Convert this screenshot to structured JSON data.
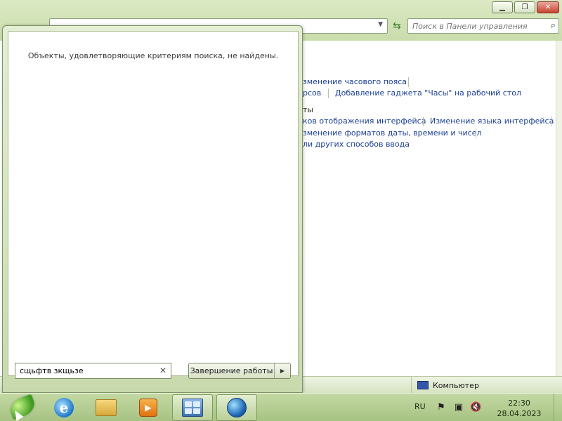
{
  "window": {
    "search_placeholder": "Поиск в Панели управления",
    "status_computer": "Компьютер"
  },
  "links": {
    "time_zone": "зменение часового пояса",
    "clocks": "рсов",
    "add_clock_gadget": "Добавление гаджета \"Часы\" на рабочий стол",
    "section_fragment": "ты",
    "display_languages": "ков отображения интерфейса",
    "change_ui_language": "Изменение языка интерфейса",
    "date_formats": "зменение форматов даты, времени и чисел",
    "input_methods": "ли других способов ввода"
  },
  "start_menu": {
    "no_results": "Объекты, удовлетворяющие критериям поиска, не найдены.",
    "search_value": "сщьфтв зкщьзе",
    "shutdown_label": "Завершение работы"
  },
  "taskbar": {
    "language": "RU",
    "time": "22:30",
    "date": "28.04.2023"
  },
  "colors": {
    "link": "#1c3f94",
    "taskbar": "#b5cd92"
  }
}
